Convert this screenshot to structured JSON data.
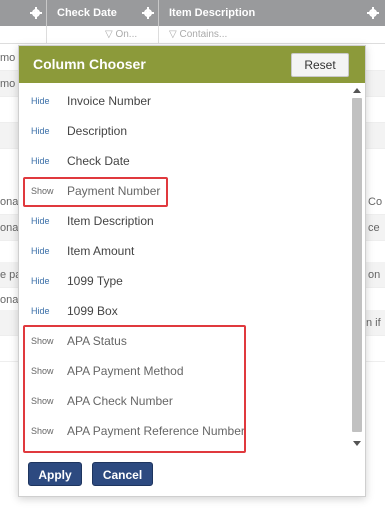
{
  "grid": {
    "header_color": "#999a9c",
    "columns": [
      {
        "label": ""
      },
      {
        "label": "Check Date"
      },
      {
        "label": "Item Description"
      }
    ],
    "filters": [
      {
        "placeholder": ""
      },
      {
        "placeholder": "On..."
      },
      {
        "placeholder": "Contains..."
      }
    ],
    "partial_rows": [
      {
        "left": "mo",
        "right": ""
      },
      {
        "left": "mo",
        "right": ""
      },
      {
        "left": "",
        "right": ""
      },
      {
        "left": "",
        "right": ""
      },
      {
        "left": "ona",
        "right": "Co"
      },
      {
        "left": "ona",
        "right": "ce"
      },
      {
        "left": "",
        "right": ""
      },
      {
        "left": "e pa",
        "right": "on"
      },
      {
        "left": "ona",
        "right": ""
      },
      {
        "left": "",
        "right": "n if"
      },
      {
        "left": "",
        "right": ""
      }
    ]
  },
  "modal": {
    "title": "Column Chooser",
    "reset_label": "Reset",
    "header_color": "#8c9a3a",
    "apply_label": "Apply",
    "cancel_label": "Cancel",
    "button_color": "#2d4a80",
    "highlight_color": "#e0393e",
    "columns": [
      {
        "toggle": "Hide",
        "label": "Invoice Number",
        "visible": true
      },
      {
        "toggle": "Hide",
        "label": "Description",
        "visible": true
      },
      {
        "toggle": "Hide",
        "label": "Check Date",
        "visible": true
      },
      {
        "toggle": "Show",
        "label": "Payment Number",
        "visible": false
      },
      {
        "toggle": "Hide",
        "label": "Item Description",
        "visible": true
      },
      {
        "toggle": "Hide",
        "label": "Item Amount",
        "visible": true
      },
      {
        "toggle": "Hide",
        "label": "1099 Type",
        "visible": true
      },
      {
        "toggle": "Hide",
        "label": "1099 Box",
        "visible": true
      },
      {
        "toggle": "Show",
        "label": "APA Status",
        "visible": false
      },
      {
        "toggle": "Show",
        "label": "APA Payment Method",
        "visible": false
      },
      {
        "toggle": "Show",
        "label": "APA Check Number",
        "visible": false
      },
      {
        "toggle": "Show",
        "label": "APA Payment Reference Number",
        "visible": false
      }
    ]
  }
}
